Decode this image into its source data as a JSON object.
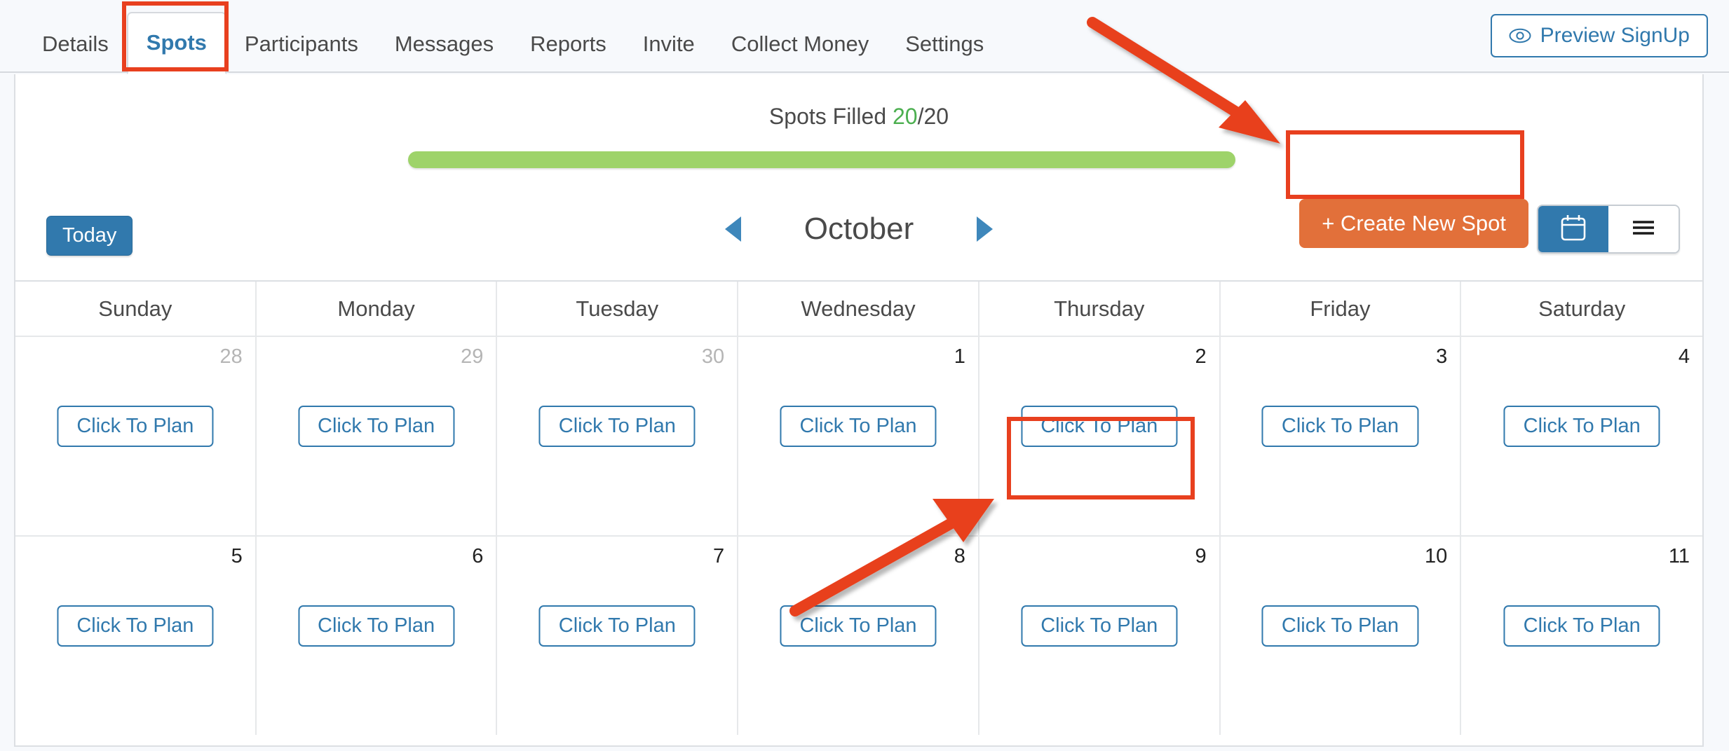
{
  "tabs": [
    {
      "label": "Details",
      "active": false
    },
    {
      "label": "Spots",
      "active": true
    },
    {
      "label": "Participants",
      "active": false
    },
    {
      "label": "Messages",
      "active": false
    },
    {
      "label": "Reports",
      "active": false
    },
    {
      "label": "Invite",
      "active": false
    },
    {
      "label": "Collect Money",
      "active": false
    },
    {
      "label": "Settings",
      "active": false
    }
  ],
  "header": {
    "preview_label": "Preview SignUp",
    "preview_icon": "eye-icon"
  },
  "spots": {
    "label_prefix": "Spots Filled ",
    "filled": "20",
    "separator": "/",
    "total": "20",
    "progress_percent": 100,
    "progress_color": "#9ed36a",
    "filled_color": "#4caf50"
  },
  "toolbar": {
    "create_label": "+ Create New Spot",
    "create_color": "#e2703a",
    "view_calendar_icon": "calendar-icon",
    "view_list_icon": "hamburger-list-icon",
    "active_view": "calendar"
  },
  "monthnav": {
    "today_label": "Today",
    "prev_icon": "triangle-left-icon",
    "next_icon": "triangle-right-icon",
    "month": "October"
  },
  "calendar": {
    "day_headers": [
      "Sunday",
      "Monday",
      "Tuesday",
      "Wednesday",
      "Thursday",
      "Friday",
      "Saturday"
    ],
    "plan_label": "Click To Plan",
    "weeks": [
      [
        {
          "day": "28",
          "muted": true,
          "plan": true,
          "highlighted": false
        },
        {
          "day": "29",
          "muted": true,
          "plan": true,
          "highlighted": false
        },
        {
          "day": "30",
          "muted": true,
          "plan": true,
          "highlighted": false
        },
        {
          "day": "1",
          "muted": false,
          "plan": true,
          "highlighted": false
        },
        {
          "day": "2",
          "muted": false,
          "plan": true,
          "highlighted": true
        },
        {
          "day": "3",
          "muted": false,
          "plan": true,
          "highlighted": false
        },
        {
          "day": "4",
          "muted": false,
          "plan": true,
          "highlighted": false
        }
      ],
      [
        {
          "day": "5",
          "muted": false,
          "plan": true,
          "highlighted": false
        },
        {
          "day": "6",
          "muted": false,
          "plan": true,
          "highlighted": false
        },
        {
          "day": "7",
          "muted": false,
          "plan": true,
          "highlighted": false
        },
        {
          "day": "8",
          "muted": false,
          "plan": true,
          "highlighted": false
        },
        {
          "day": "9",
          "muted": false,
          "plan": true,
          "highlighted": false
        },
        {
          "day": "10",
          "muted": false,
          "plan": true,
          "highlighted": false
        },
        {
          "day": "11",
          "muted": false,
          "plan": true,
          "highlighted": false
        }
      ]
    ]
  },
  "annotations": {
    "color": "#e8401f",
    "boxes": [
      "spots-tab",
      "create-new-spot-button",
      "thursday-2-click-to-plan"
    ],
    "arrows": [
      "arrow-to-create-new-spot",
      "arrow-to-click-to-plan"
    ]
  }
}
